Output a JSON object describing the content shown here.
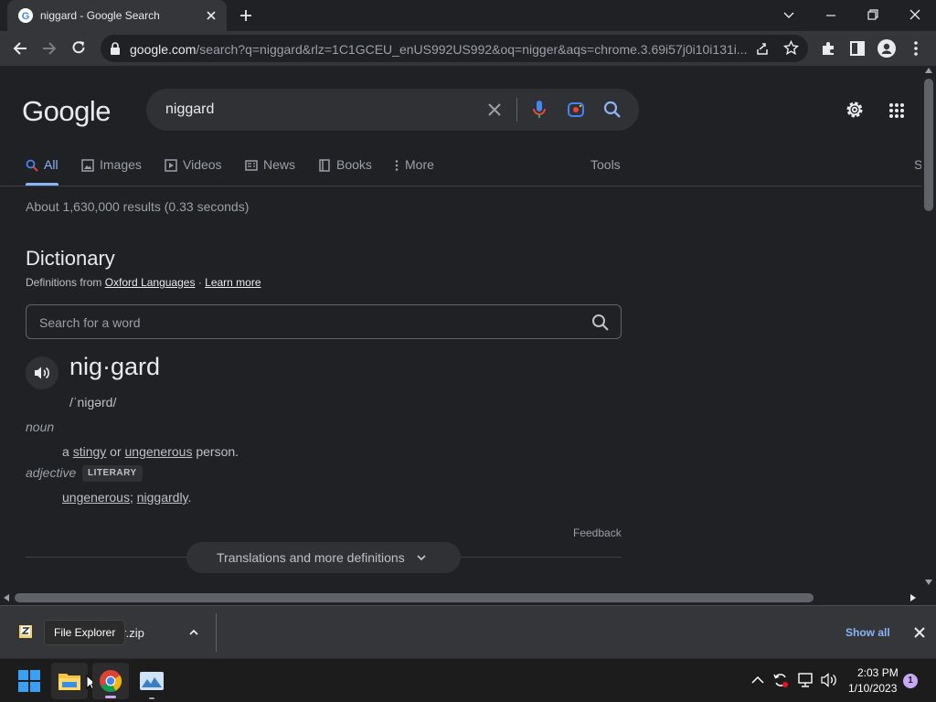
{
  "browser": {
    "tab_title": "niggard - Google Search",
    "url_host": "google.com",
    "url_path": "/search?q=niggard&rlz=1C1GCEU_enUS992US992&oq=nigger&aqs=chrome.3.69i57j0i10i131i..."
  },
  "google": {
    "logo": "Google",
    "query": "niggard",
    "tabs": {
      "all": "All",
      "images": "Images",
      "videos": "Videos",
      "news": "News",
      "books": "Books",
      "more": "More",
      "tools": "Tools",
      "cut_off": "S"
    },
    "result_stats": "About 1,630,000 results (0.33 seconds)"
  },
  "dictionary": {
    "title": "Dictionary",
    "source_prefix": "Definitions from",
    "source_link": "Oxford Languages",
    "separator": "·",
    "learn_more": "Learn more",
    "search_placeholder": "Search for a word",
    "headword": "nig·gard",
    "phonetic": "/ˈniɡərd/",
    "noun_label": "noun",
    "noun_def": {
      "a": "a",
      "w1": "stingy",
      "or": "or",
      "w2": "ungenerous",
      "rest": "person."
    },
    "adjective_label": "adjective",
    "adjective_badge": "LITERARY",
    "adj_def": {
      "w1": "ungenerous",
      "semi": ";",
      "w2": "niggardly",
      "dot": "."
    },
    "feedback": "Feedback",
    "more_defs": "Translations and more definitions"
  },
  "downloads": {
    "file_name": "r.zip",
    "tooltip": "File Explorer",
    "show_all": "Show all"
  },
  "taskbar": {
    "time": "2:03 PM",
    "date": "1/10/2023",
    "notifications": "1"
  }
}
